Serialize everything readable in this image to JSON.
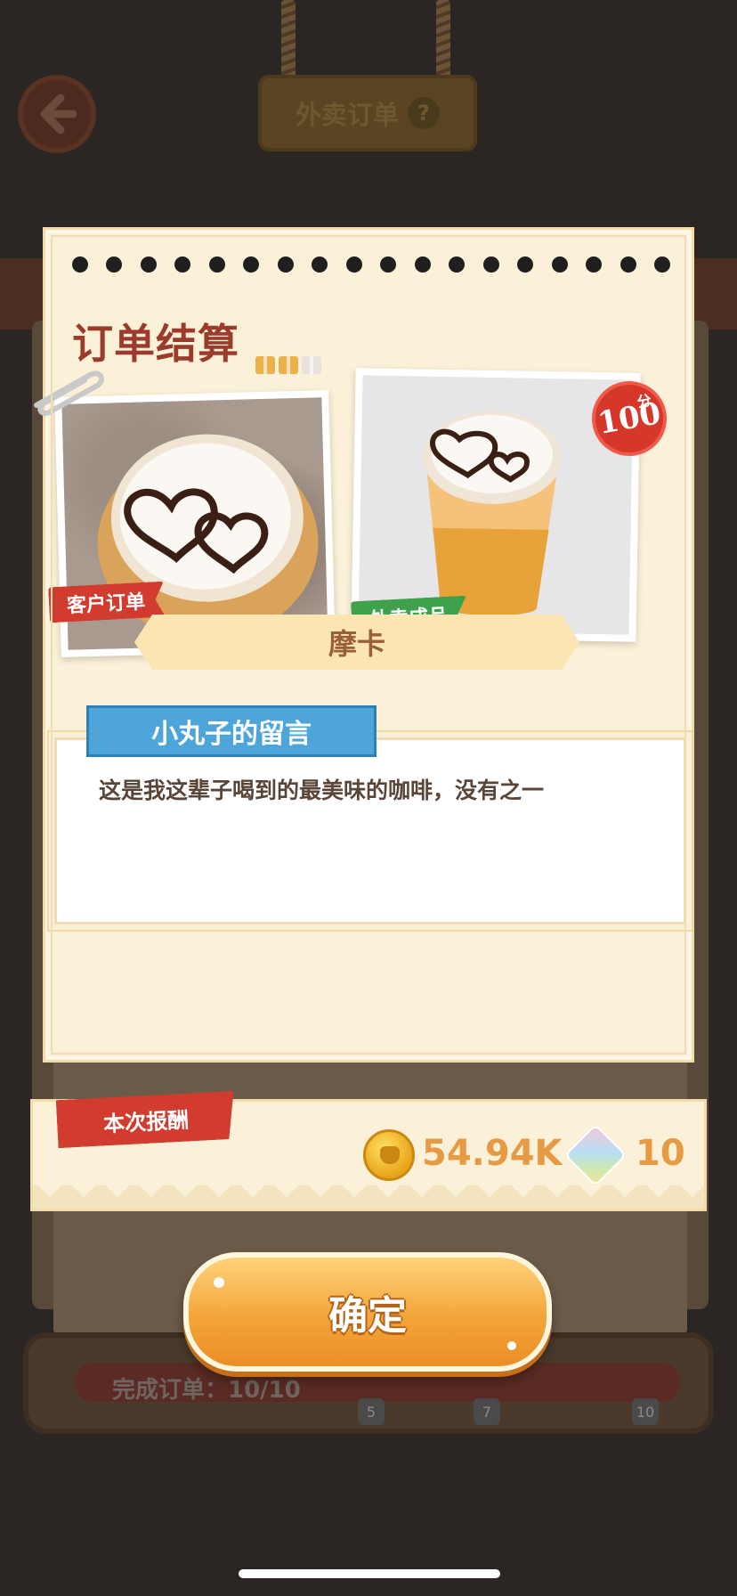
{
  "header": {
    "title": "外卖订单",
    "help_label": "?"
  },
  "dialog": {
    "section_title": "订单结算",
    "customer_order_tag": "客户订单",
    "finished_product_tag": "外卖成品",
    "score": {
      "value": "100",
      "unit": "分"
    },
    "gifts": {
      "earned": 2,
      "total": 3
    },
    "product_name": "摩卡",
    "message": {
      "header": "小丸子的留言",
      "text": "这是我这辈子喝到的最美味的咖啡，没有之一"
    }
  },
  "reward": {
    "label": "本次报酬",
    "coins": "54.94K",
    "gems": "10"
  },
  "confirm_label": "确定",
  "background": {
    "progress_text": "完成订单：10/10",
    "milestones": [
      "5",
      "7",
      "10"
    ]
  },
  "colors": {
    "title_red": "#9c3b2c",
    "tag_red": "#d23c2e",
    "tag_green": "#3ea14c",
    "message_blue": "#4ea5d9",
    "reward_orange": "#e69a43",
    "button_orange": "#f3a53a"
  }
}
